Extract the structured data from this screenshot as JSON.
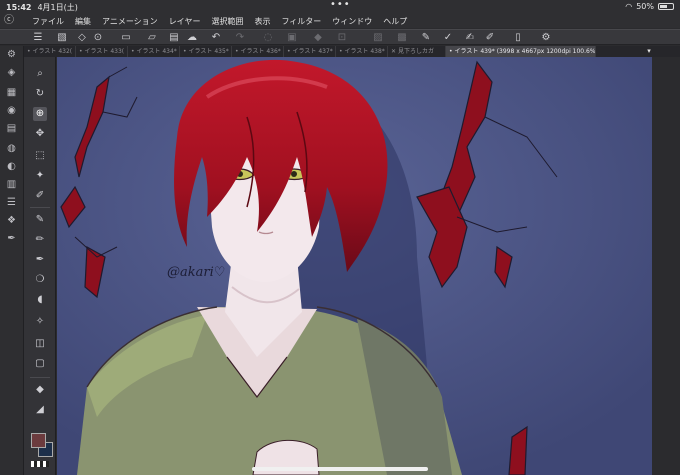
{
  "status": {
    "time": "15:42",
    "date": "4月1日(土)",
    "battery": "50%"
  },
  "menu": {
    "items": [
      "ファイル",
      "編集",
      "アニメーション",
      "レイヤー",
      "選択範囲",
      "表示",
      "フィルター",
      "ウィンドウ",
      "ヘルプ"
    ]
  },
  "tabs": [
    {
      "label": "イラスト 432(",
      "active": false,
      "prefix": "•"
    },
    {
      "label": "イラスト 433(",
      "active": false,
      "prefix": "•"
    },
    {
      "label": "イラスト 434*",
      "active": false,
      "prefix": "•"
    },
    {
      "label": "イラスト 435*",
      "active": false,
      "prefix": "•"
    },
    {
      "label": "イラスト 436*",
      "active": false,
      "prefix": "•"
    },
    {
      "label": "イラスト 437*",
      "active": false,
      "prefix": "•"
    },
    {
      "label": "イラスト 438*",
      "active": false,
      "prefix": "•"
    },
    {
      "label": "見下ろしカガ",
      "active": false,
      "prefix": "✕"
    },
    {
      "label": "イラスト 439* (3998 x 4667px 1200dpi 100.6%)",
      "active": true,
      "prefix": "•"
    }
  ],
  "canvas": {
    "signature": "@akari♡",
    "background": "#434c7a"
  },
  "colors": {
    "main_color": "#6c3b3e",
    "sub_color": "#1d2f4a"
  }
}
